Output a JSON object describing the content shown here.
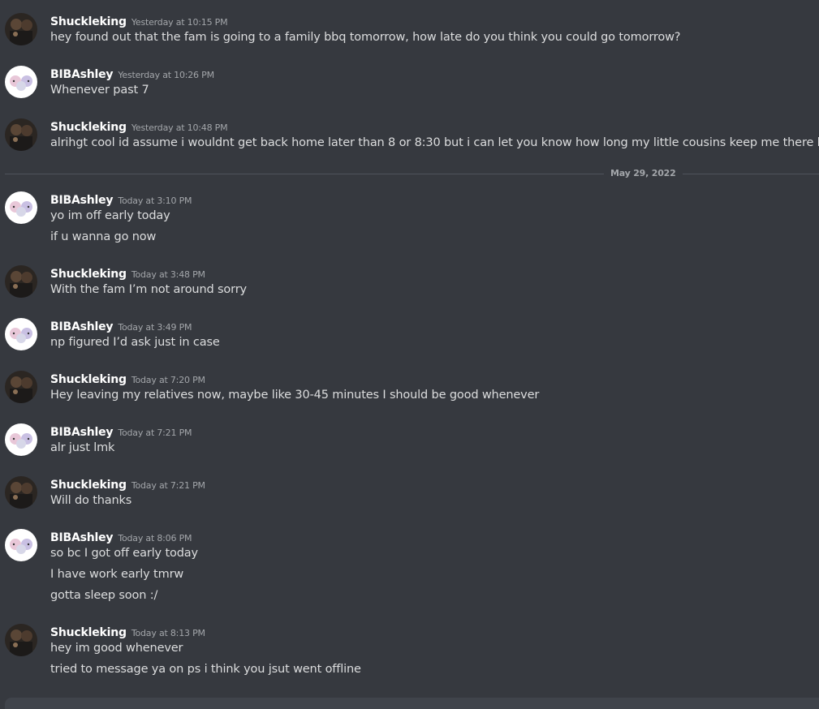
{
  "date_divider": "May 29, 2022",
  "colors": {
    "background": "#36393f",
    "username": "#ffffff",
    "timestamp": "#a3a6aa",
    "text": "#dcddde",
    "divider": "#4f545c"
  },
  "messages": [
    {
      "author": "Shuckleking",
      "avatar": "photo-avatar",
      "time": "Yesterday at 10:15 PM",
      "lines": [
        "hey found out that the fam is going to a family bbq tomorrow, how late do you think you could go tomorrow?"
      ]
    },
    {
      "author": "BIBAshley",
      "avatar": "cartoon-sheep-avatar",
      "time": "Yesterday at 10:26 PM",
      "lines": [
        "Whenever past 7"
      ]
    },
    {
      "author": "Shuckleking",
      "avatar": "photo-avatar",
      "time": "Yesterday at 10:48 PM",
      "lines": [
        "alrihgt cool id assume i wouldnt get back home later than 8 or 8:30 but i can let you know how long my little cousins keep me there lol"
      ]
    },
    {
      "author": "BIBAshley",
      "avatar": "cartoon-sheep-avatar",
      "time": "Today at 3:10 PM",
      "lines": [
        "yo im off early today",
        "if u wanna go now"
      ]
    },
    {
      "author": "Shuckleking",
      "avatar": "photo-avatar",
      "time": "Today at 3:48 PM",
      "lines": [
        "With the fam I’m not around sorry"
      ]
    },
    {
      "author": "BIBAshley",
      "avatar": "cartoon-sheep-avatar",
      "time": "Today at 3:49 PM",
      "lines": [
        "np figured I’d ask just in case"
      ]
    },
    {
      "author": "Shuckleking",
      "avatar": "photo-avatar",
      "time": "Today at 7:20 PM",
      "lines": [
        "Hey leaving my relatives now, maybe like 30-45 minutes I should be good whenever"
      ]
    },
    {
      "author": "BIBAshley",
      "avatar": "cartoon-sheep-avatar",
      "time": "Today at 7:21 PM",
      "lines": [
        "alr just lmk"
      ]
    },
    {
      "author": "Shuckleking",
      "avatar": "photo-avatar",
      "time": "Today at 7:21 PM",
      "lines": [
        "Will do thanks"
      ]
    },
    {
      "author": "BIBAshley",
      "avatar": "cartoon-sheep-avatar",
      "time": "Today at 8:06 PM",
      "lines": [
        "so bc I got off early today",
        "I have work early tmrw",
        "gotta sleep soon :/"
      ]
    },
    {
      "author": "Shuckleking",
      "avatar": "photo-avatar",
      "time": "Today at 8:13 PM",
      "lines": [
        "hey im good whenever",
        "tried to message ya on ps i think you jsut went offline"
      ]
    }
  ]
}
